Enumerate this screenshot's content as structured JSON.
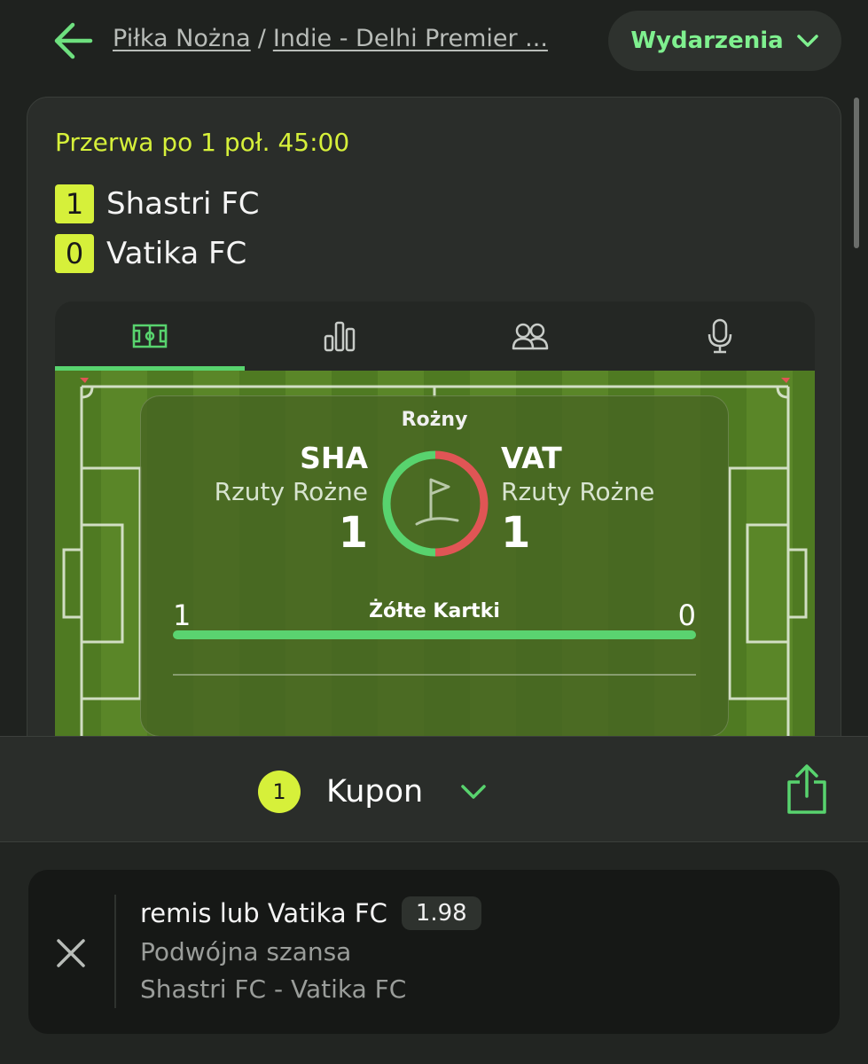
{
  "breadcrumb": {
    "sport": "Piłka Nożna",
    "league": "Indie - Delhi Premier ..."
  },
  "events_button": {
    "label": "Wydarzenia"
  },
  "match": {
    "status": "Przerwa po 1 poł. 45:00",
    "home": {
      "score": "1",
      "name": "Shastri FC"
    },
    "away": {
      "score": "0",
      "name": "Vatika FC"
    }
  },
  "tabs": [
    {
      "icon": "pitch-icon",
      "active": true
    },
    {
      "icon": "stats-bars-icon",
      "active": false
    },
    {
      "icon": "lineups-icon",
      "active": false
    },
    {
      "icon": "microphone-icon",
      "active": false
    }
  ],
  "live_overlay": {
    "event_title": "Rożny",
    "home": {
      "abbr": "SHA",
      "stat_label": "Rzuty Rożne",
      "stat_value": "1"
    },
    "away": {
      "abbr": "VAT",
      "stat_label": "Rzuty Rożne",
      "stat_value": "1"
    },
    "yellow_cards": {
      "label": "Żółte Kartki",
      "home": "1",
      "away": "0"
    }
  },
  "coupon": {
    "count": "1",
    "label": "Kupon"
  },
  "bet": {
    "selection": "remis lub Vatika FC",
    "odds": "1.98",
    "market": "Podwójna szansa",
    "event": "Shastri FC - Vatika FC"
  },
  "colors": {
    "accent_green": "#58d36e",
    "accent_yellow": "#d6f03a",
    "corner_red": "#e05555",
    "background": "#1f221f"
  }
}
